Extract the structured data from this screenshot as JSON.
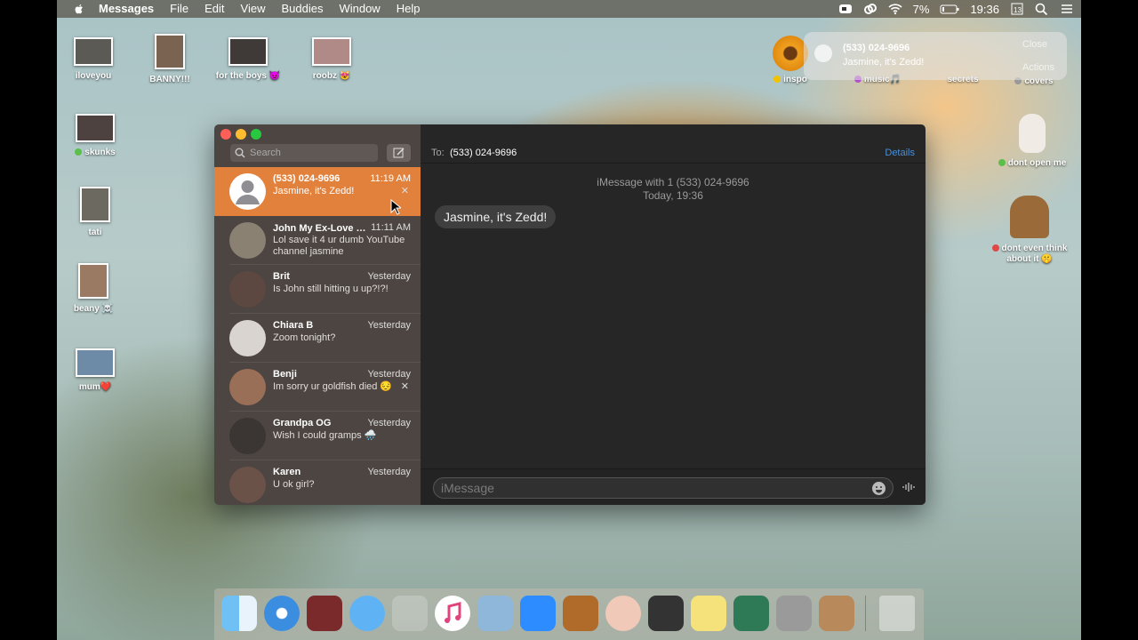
{
  "menubar": {
    "app_name": "Messages",
    "menus": [
      "File",
      "Edit",
      "View",
      "Buddies",
      "Window",
      "Help"
    ],
    "battery": "7%",
    "time": "19:36"
  },
  "desktop_icons": [
    {
      "label": "iloveyou"
    },
    {
      "label": "BANNY!!!"
    },
    {
      "label": "for the boys 😈"
    },
    {
      "label": "roobz 😻"
    },
    {
      "label": "skunks"
    },
    {
      "label": "tati"
    },
    {
      "label": "beany ☠️"
    },
    {
      "label": "mum❤️"
    },
    {
      "label": "inspo"
    },
    {
      "label": "music🎵"
    },
    {
      "label": "secrets"
    },
    {
      "label": "covers"
    },
    {
      "label": "dont open me"
    },
    {
      "label": "dont even think about it 🤫"
    }
  ],
  "notification": {
    "sender": "(533) 024-9696",
    "preview": "Jasmine, it's Zedd!",
    "close": "Close",
    "actions": "Actions"
  },
  "sidebar": {
    "search_placeholder": "Search",
    "conversations": [
      {
        "name": "(533) 024-9696",
        "time": "11:19 AM",
        "preview": "Jasmine, it's Zedd!",
        "selected": true
      },
      {
        "name": "John My Ex-Love 🤮 Nope",
        "time": "11:11 AM",
        "preview": "Lol save it 4 ur dumb YouTube channel jasmine"
      },
      {
        "name": "Brit",
        "time": "Yesterday",
        "preview": "Is John still hitting u up?!?!"
      },
      {
        "name": "Chiara B",
        "time": "Yesterday",
        "preview": "Zoom tonight?"
      },
      {
        "name": "Benji",
        "time": "Yesterday",
        "preview": "Im sorry ur goldfish died 😔"
      },
      {
        "name": "Grandpa OG",
        "time": "Yesterday",
        "preview": "Wish I could gramps 🌧️"
      },
      {
        "name": "Karen",
        "time": "Yesterday",
        "preview": "U ok girl?"
      }
    ]
  },
  "chat": {
    "to_label": "To:",
    "to_value": "(533) 024-9696",
    "details": "Details",
    "meta_line1": "iMessage with 1 (533) 024-9696",
    "meta_line2": "Today, 19:36",
    "message": "Jasmine, it's Zedd!",
    "input_placeholder": "iMessage"
  },
  "colors": {
    "selection": "#e2813b",
    "details_link": "#4a90d9"
  }
}
